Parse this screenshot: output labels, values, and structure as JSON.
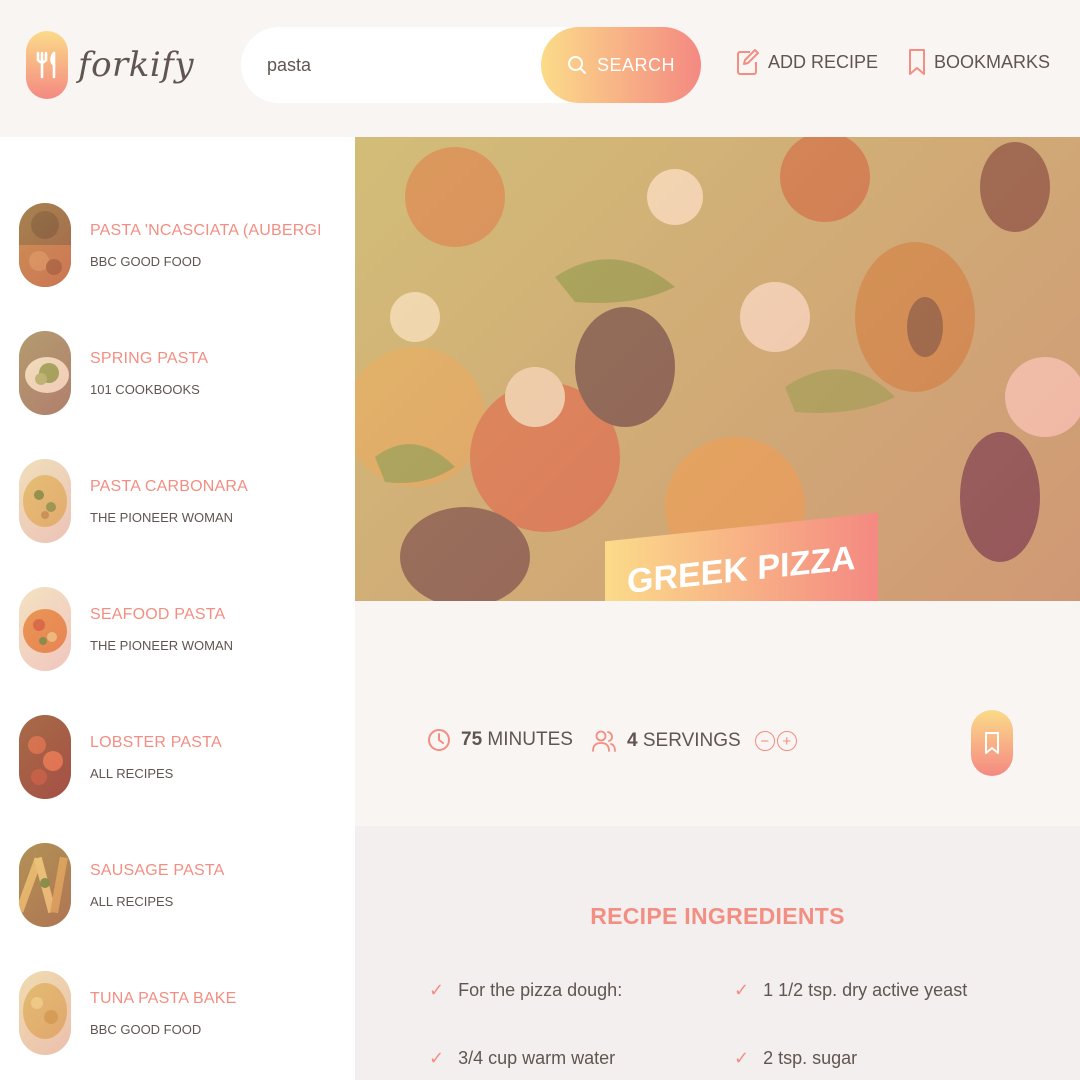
{
  "brand": {
    "name": "forkify"
  },
  "search": {
    "value": "pasta",
    "button_label": "SEARCH"
  },
  "nav": {
    "add_recipe": "ADD RECIPE",
    "bookmarks": "BOOKMARKS"
  },
  "results": [
    {
      "title": "PASTA 'NCASCIATA (AUBERGINE ...",
      "publisher": "BBC GOOD FOOD"
    },
    {
      "title": "SPRING PASTA",
      "publisher": "101 COOKBOOKS"
    },
    {
      "title": "PASTA CARBONARA",
      "publisher": "THE PIONEER WOMAN"
    },
    {
      "title": "SEAFOOD PASTA",
      "publisher": "THE PIONEER WOMAN"
    },
    {
      "title": "LOBSTER PASTA",
      "publisher": "ALL RECIPES"
    },
    {
      "title": "SAUSAGE PASTA",
      "publisher": "ALL RECIPES"
    },
    {
      "title": "TUNA PASTA BAKE",
      "publisher": "BBC GOOD FOOD"
    }
  ],
  "recipe": {
    "title": "GREEK PIZZA",
    "minutes": "75",
    "minutes_label": "MINUTES",
    "servings": "4",
    "servings_label": "SERVINGS",
    "ingredients_heading": "RECIPE INGREDIENTS",
    "ingredients": [
      "For the pizza dough:",
      "1 1/2 tsp. dry active yeast",
      "3/4 cup warm water",
      "2 tsp. sugar"
    ]
  },
  "colors": {
    "accent": "#f38e82",
    "gradient_start": "#fbdb89",
    "gradient_end": "#f48982",
    "text": "#615551",
    "background": "#f9f5f3"
  }
}
